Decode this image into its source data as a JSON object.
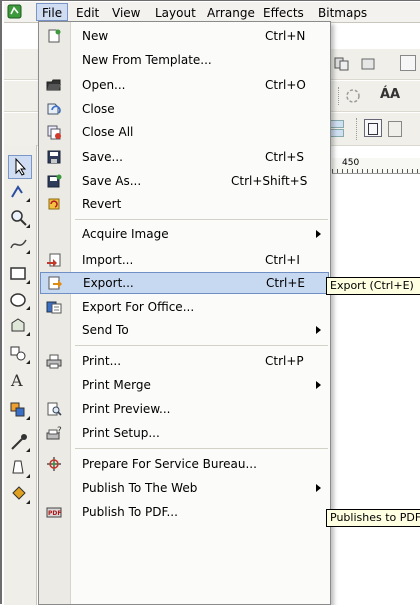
{
  "menubar": {
    "items": [
      {
        "label": "File",
        "active": true
      },
      {
        "label": "Edit"
      },
      {
        "label": "View"
      },
      {
        "label": "Layout"
      },
      {
        "label": "Arrange"
      },
      {
        "label": "Effects"
      },
      {
        "label": "Bitmaps"
      }
    ]
  },
  "ruler": {
    "mark": "450"
  },
  "zoom_glyph": "ÁA",
  "file_menu": {
    "items": [
      {
        "label": "New",
        "shortcut": "Ctrl+N",
        "icon": "new-document-icon"
      },
      {
        "label": "New From Template...",
        "shortcut": "",
        "icon": ""
      },
      {
        "label": "Open...",
        "shortcut": "Ctrl+O",
        "icon": "open-folder-icon"
      },
      {
        "label": "Close",
        "shortcut": "",
        "icon": "close-document-icon"
      },
      {
        "label": "Close All",
        "shortcut": "",
        "icon": "close-all-icon"
      },
      {
        "label": "Save...",
        "shortcut": "Ctrl+S",
        "icon": "save-icon"
      },
      {
        "label": "Save As...",
        "shortcut": "Ctrl+Shift+S",
        "icon": "save-as-icon"
      },
      {
        "label": "Revert",
        "shortcut": "",
        "icon": "revert-icon"
      },
      {
        "label": "Acquire Image",
        "shortcut": "",
        "icon": "",
        "submenu": true
      },
      {
        "label": "Import...",
        "shortcut": "Ctrl+I",
        "icon": "import-icon"
      },
      {
        "label": "Export...",
        "shortcut": "Ctrl+E",
        "icon": "export-icon",
        "highlighted": true
      },
      {
        "label": "Export For Office...",
        "shortcut": "",
        "icon": "export-office-icon"
      },
      {
        "label": "Send To",
        "shortcut": "",
        "icon": "",
        "submenu": true
      },
      {
        "label": "Print...",
        "shortcut": "Ctrl+P",
        "icon": "print-icon"
      },
      {
        "label": "Print Merge",
        "shortcut": "",
        "icon": "",
        "submenu": true
      },
      {
        "label": "Print Preview...",
        "shortcut": "",
        "icon": "print-preview-icon"
      },
      {
        "label": "Print Setup...",
        "shortcut": "",
        "icon": "print-setup-icon"
      },
      {
        "label": "Prepare For Service Bureau...",
        "shortcut": "",
        "icon": "service-bureau-icon"
      },
      {
        "label": "Publish To The Web",
        "shortcut": "",
        "icon": "",
        "submenu": true
      },
      {
        "label": "Publish To PDF...",
        "shortcut": "",
        "icon": "pdf-icon"
      }
    ]
  },
  "tooltips": {
    "export": "Export (Ctrl+E)",
    "pdf": "Publishes to PDF"
  },
  "colors": {
    "highlight_bg": "#c7d8f1",
    "highlight_border": "#6f8fc5",
    "tooltip_bg": "#ffffe1"
  }
}
